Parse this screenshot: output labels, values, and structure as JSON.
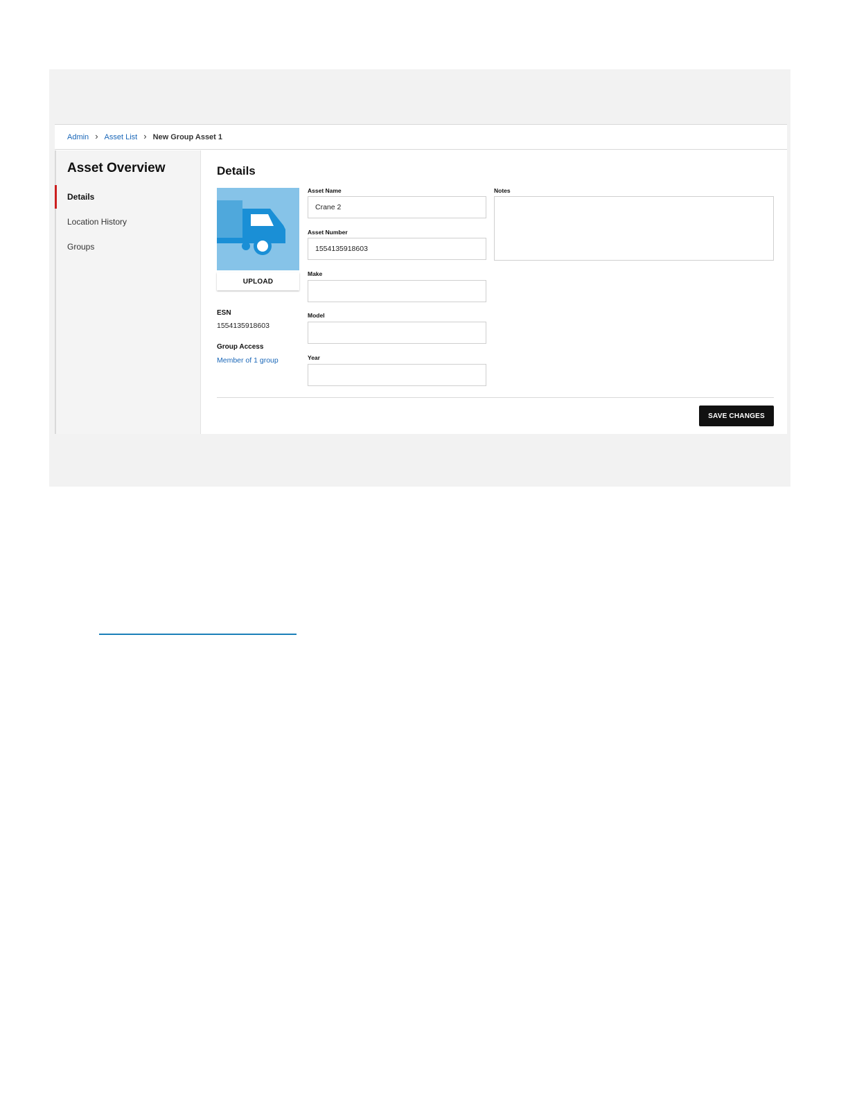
{
  "breadcrumb": {
    "items": [
      "Admin",
      "Asset List"
    ],
    "current": "New Group Asset 1"
  },
  "sidebar": {
    "title": "Asset Overview",
    "items": [
      "Details",
      "Location History",
      "Groups"
    ],
    "active_index": 0
  },
  "details": {
    "title": "Details",
    "image_icon": "truck-icon",
    "upload_label": "UPLOAD",
    "esn_label": "ESN",
    "esn_value": "1554135918603",
    "group_access_label": "Group Access",
    "group_access_link": "Member of 1 group",
    "fields": {
      "asset_name": {
        "label": "Asset Name",
        "value": "Crane 2"
      },
      "asset_number": {
        "label": "Asset Number",
        "value": "1554135918603"
      },
      "make": {
        "label": "Make",
        "value": ""
      },
      "model": {
        "label": "Model",
        "value": ""
      },
      "year": {
        "label": "Year",
        "value": ""
      }
    },
    "notes_label": "Notes",
    "notes_value": "",
    "save_label": "SAVE CHANGES"
  },
  "colors": {
    "accent": "#cc1f1f",
    "link": "#1a67b8",
    "image_bg": "#86c3e8",
    "truck": "#1a8fd6"
  }
}
